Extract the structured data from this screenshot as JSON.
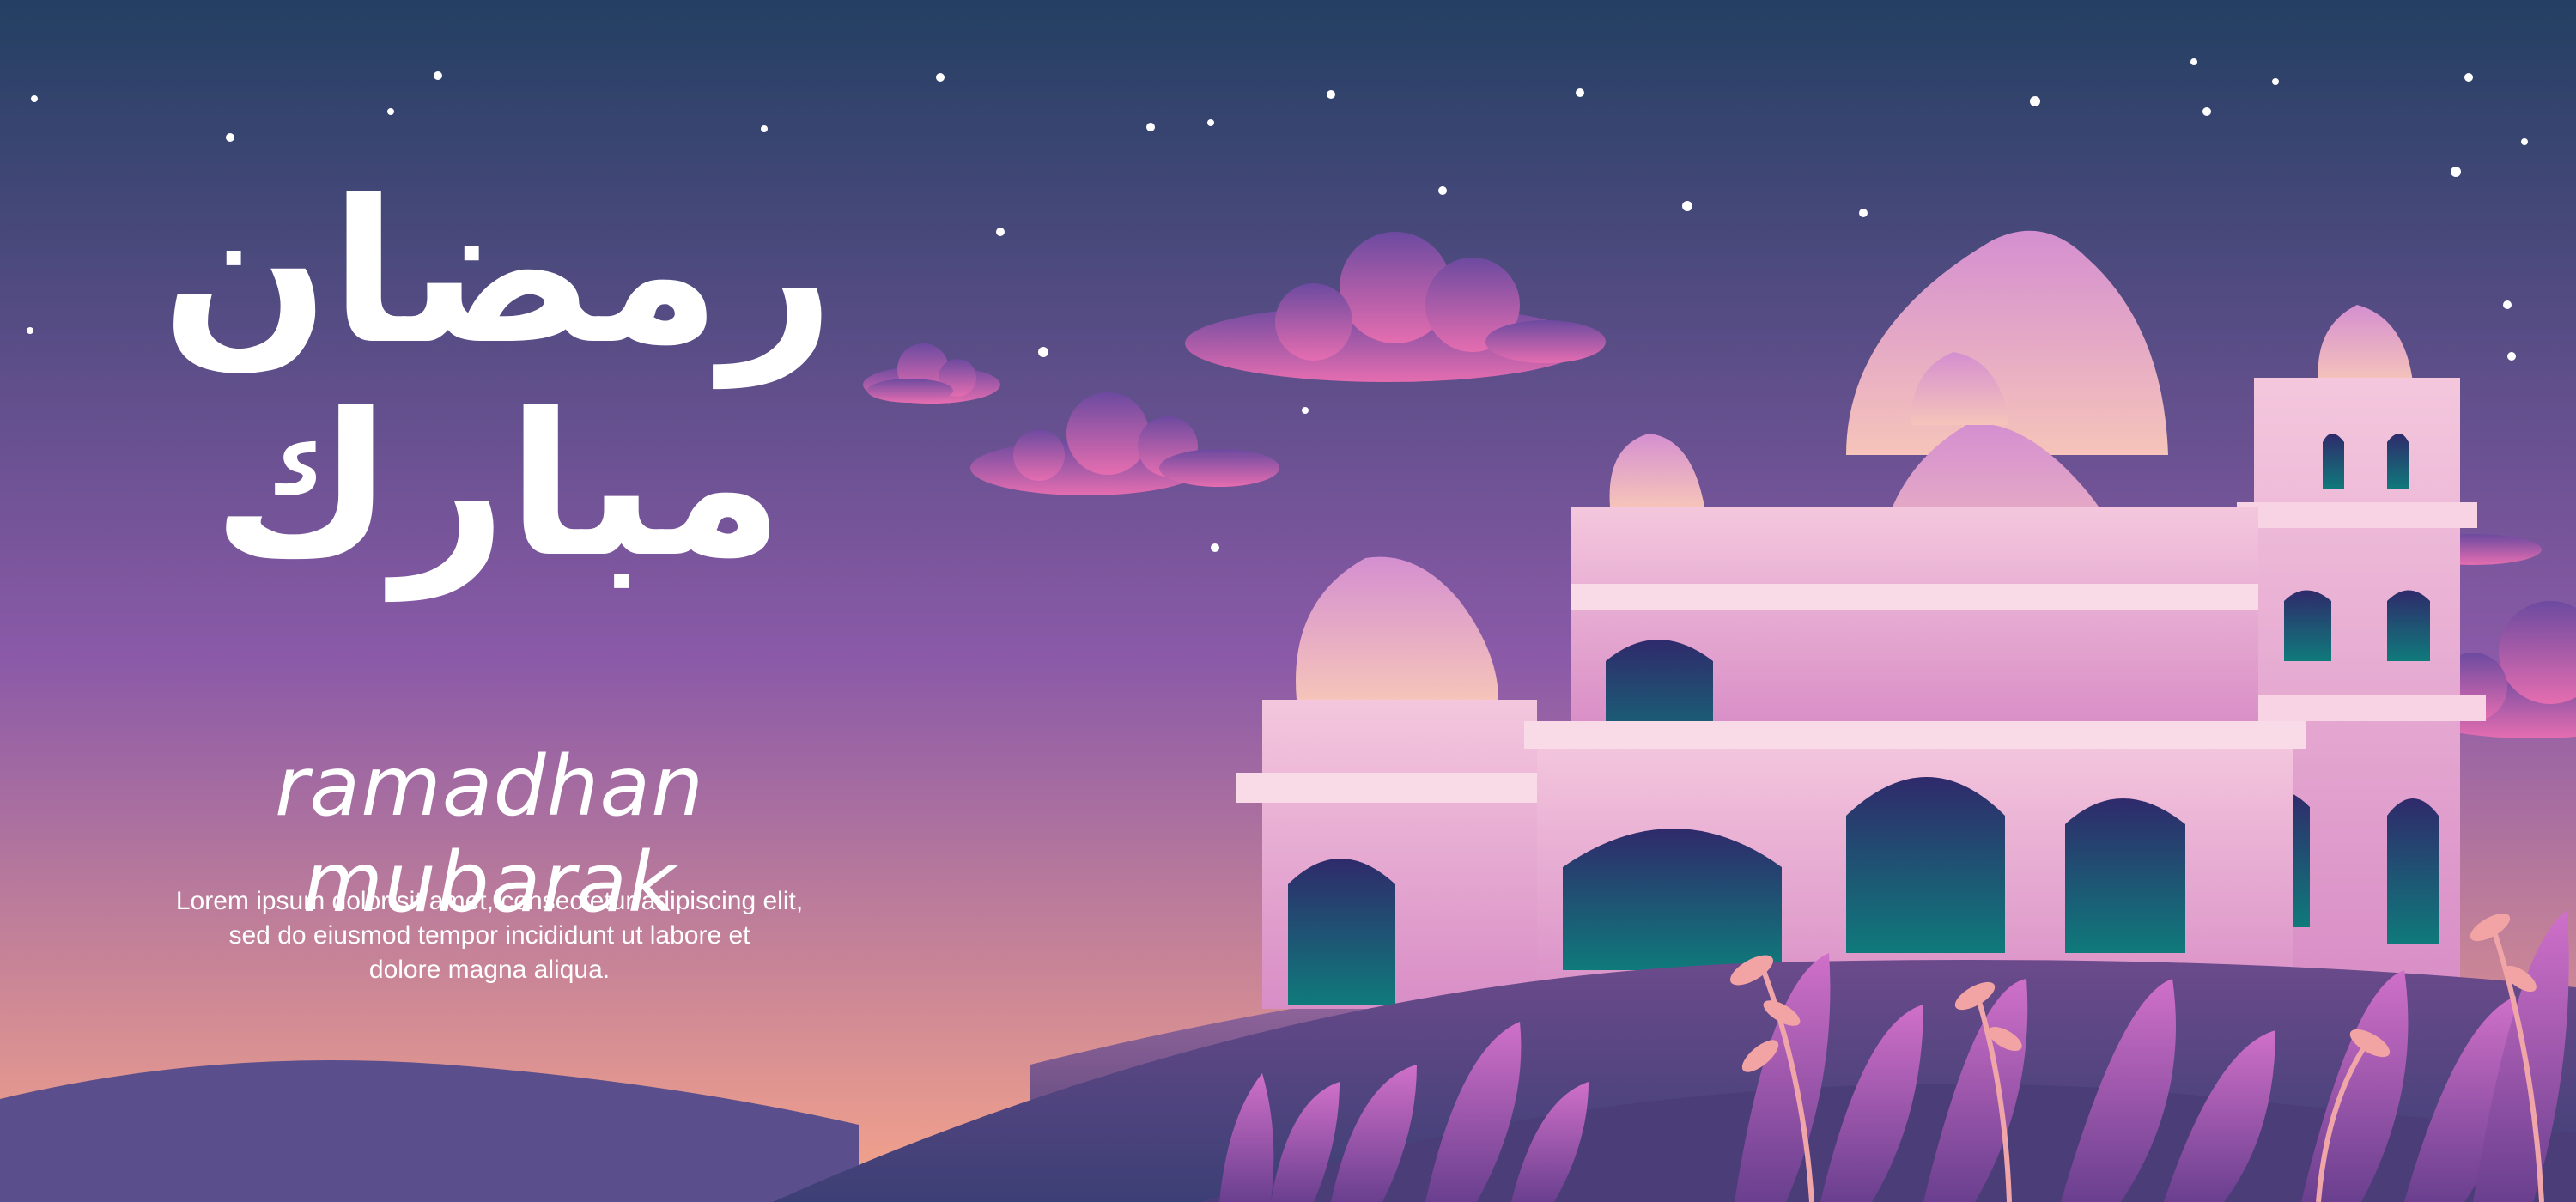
{
  "banner": {
    "arabic_line_1": "رمضان",
    "arabic_line_2": "مبارك",
    "title": "ramadhan mubarak",
    "body_lines": [
      "Lorem ipsum dolor sit amet, consectetur adipiscing elit,",
      "sed do eiusmod tempor incididunt ut labore et",
      "dolore magna aliqua."
    ]
  },
  "colors": {
    "sky_top": "#233f62",
    "sky_mid": "#8b5aa8",
    "sky_bottom": "#f7a58a",
    "mosque_light": "#f4c7dd",
    "mosque_mid": "#d88dc6",
    "window": "#0f6a73",
    "hill": "#6b4a8b"
  },
  "scene": {
    "subject": "mosque",
    "elements": [
      "stars",
      "clouds",
      "domes",
      "minarets",
      "hills",
      "plants"
    ]
  }
}
